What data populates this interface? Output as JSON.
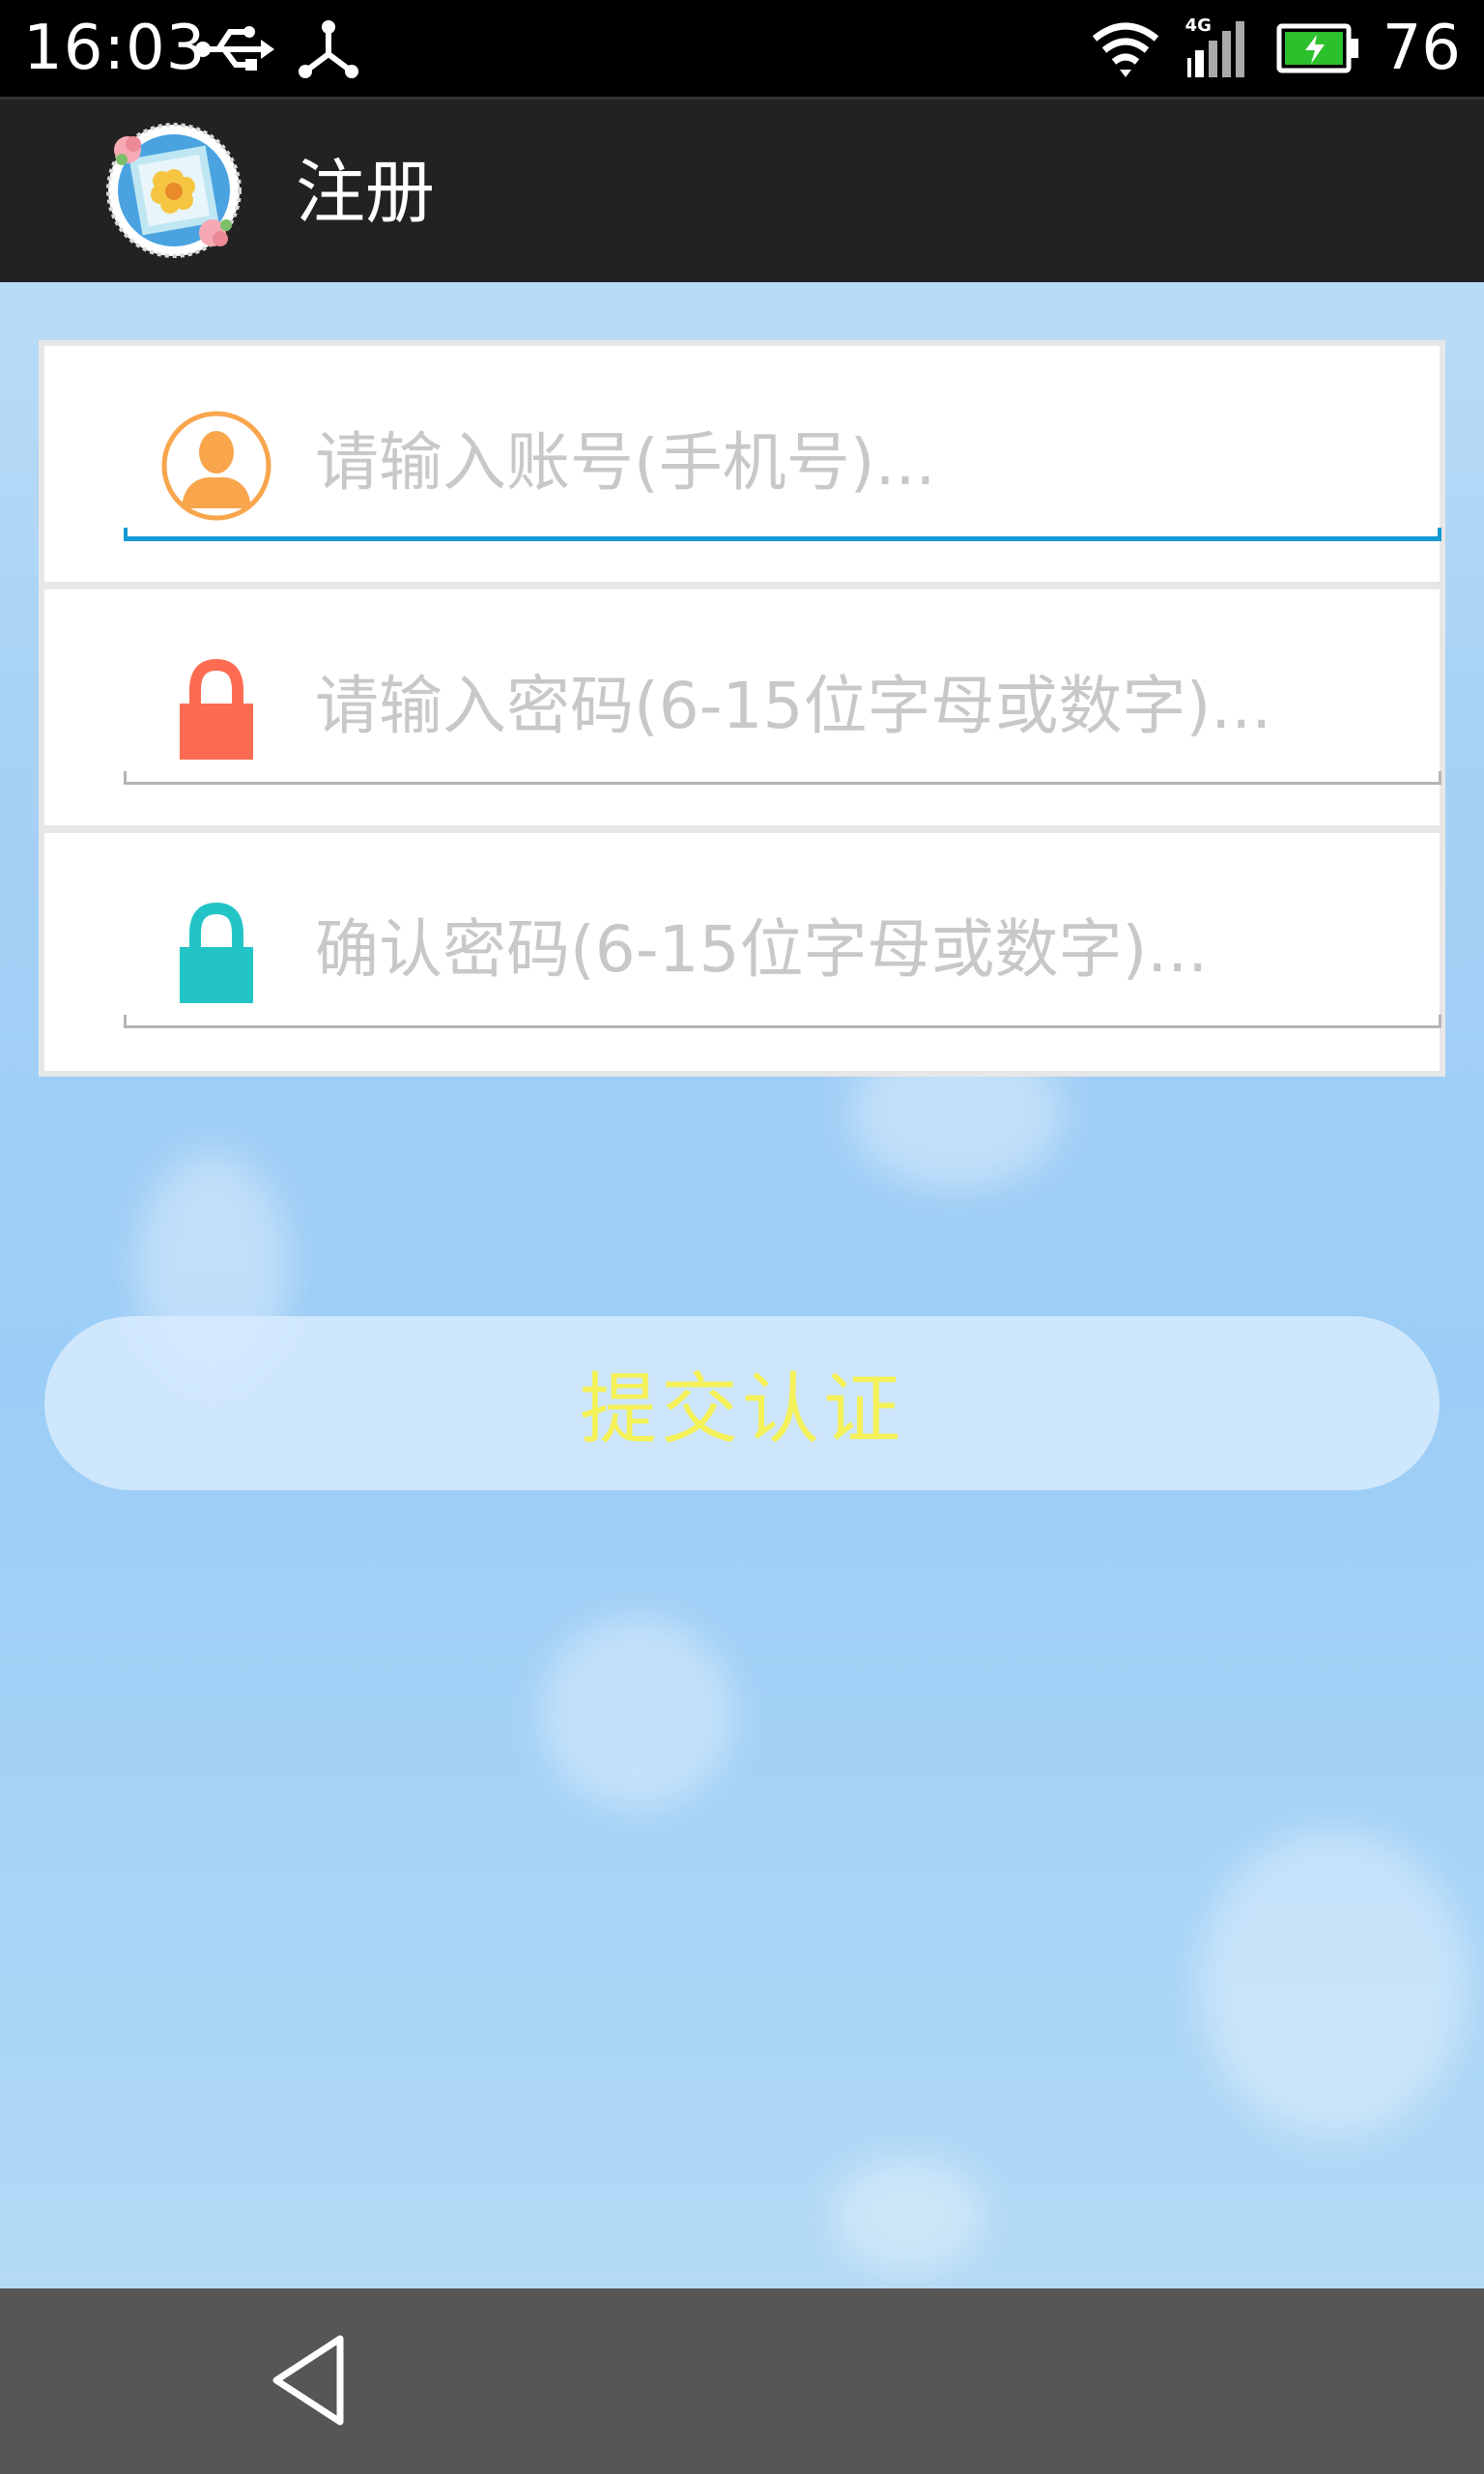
{
  "status_bar": {
    "time": "16:03",
    "network": "4G",
    "battery_percent": "76",
    "icons": [
      "usb-icon",
      "share-icon",
      "wifi-icon",
      "signal-icon",
      "battery-charging-icon"
    ]
  },
  "action_bar": {
    "title": "注册",
    "logo_icon": "app-logo-flower"
  },
  "form": {
    "account": {
      "placeholder": "请输入账号(手机号)...",
      "icon": "user-icon",
      "icon_color": "#f8a54c"
    },
    "password": {
      "placeholder": "请输入密码(6-15位字母或数字)...",
      "icon": "lock-icon",
      "icon_color": "#fd6c52"
    },
    "confirm_password": {
      "placeholder": "确认密码(6-15位字母或数字)...",
      "icon": "lock-icon",
      "icon_color": "#22c4c6"
    },
    "active_underline_color": "#169bd5"
  },
  "submit": {
    "label": "提交认证",
    "label_color": "#f6f35a"
  },
  "nav_bar": {
    "back_icon": "back-icon"
  }
}
